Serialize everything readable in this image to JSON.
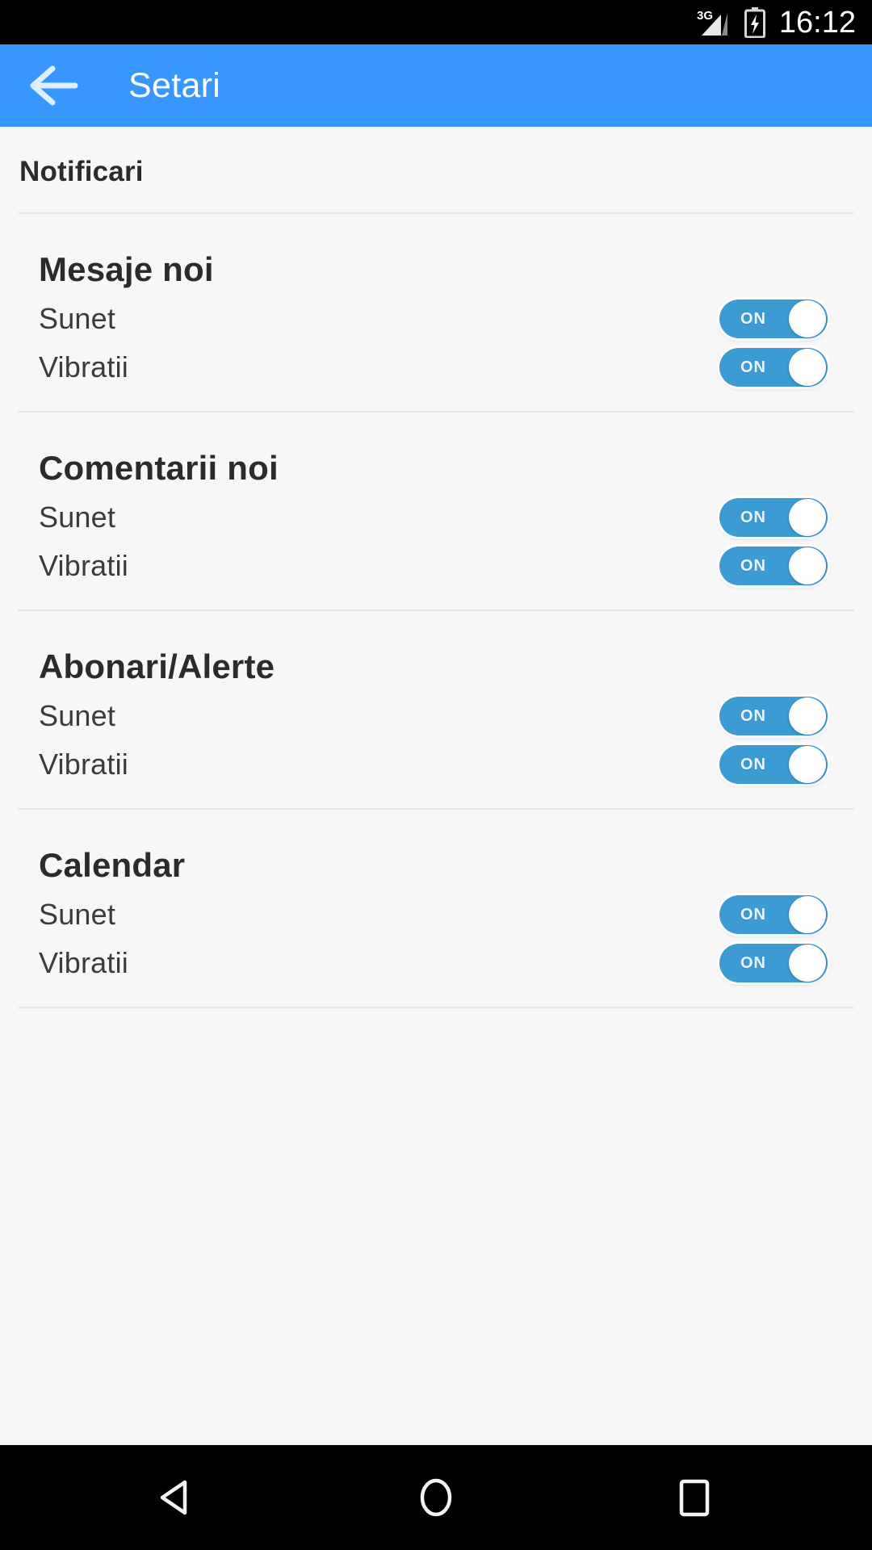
{
  "status_bar": {
    "network_label": "3G",
    "signal_icon": "signal-bars-icon",
    "battery_icon": "battery-charging-icon",
    "clock": "16:12"
  },
  "app_bar": {
    "back_icon": "arrow-left-icon",
    "title": "Setari",
    "accent_color": "#3896ff"
  },
  "content": {
    "section_header": "Notificari",
    "groups": [
      {
        "title": "Mesaje noi",
        "rows": [
          {
            "label": "Sunet",
            "toggle_state": "ON"
          },
          {
            "label": "Vibratii",
            "toggle_state": "ON"
          }
        ]
      },
      {
        "title": "Comentarii noi",
        "rows": [
          {
            "label": "Sunet",
            "toggle_state": "ON"
          },
          {
            "label": "Vibratii",
            "toggle_state": "ON"
          }
        ]
      },
      {
        "title": "Abonari/Alerte",
        "rows": [
          {
            "label": "Sunet",
            "toggle_state": "ON"
          },
          {
            "label": "Vibratii",
            "toggle_state": "ON"
          }
        ]
      },
      {
        "title": "Calendar",
        "rows": [
          {
            "label": "Sunet",
            "toggle_state": "ON"
          },
          {
            "label": "Vibratii",
            "toggle_state": "ON"
          }
        ]
      }
    ],
    "toggle_color": "#3d9bd4",
    "background_color": "#f7f7f8",
    "divider_color": "#e6e6e8"
  },
  "nav_bar": {
    "back_icon": "nav-back-triangle-icon",
    "home_icon": "nav-home-circle-icon",
    "recents_icon": "nav-recents-square-icon"
  }
}
